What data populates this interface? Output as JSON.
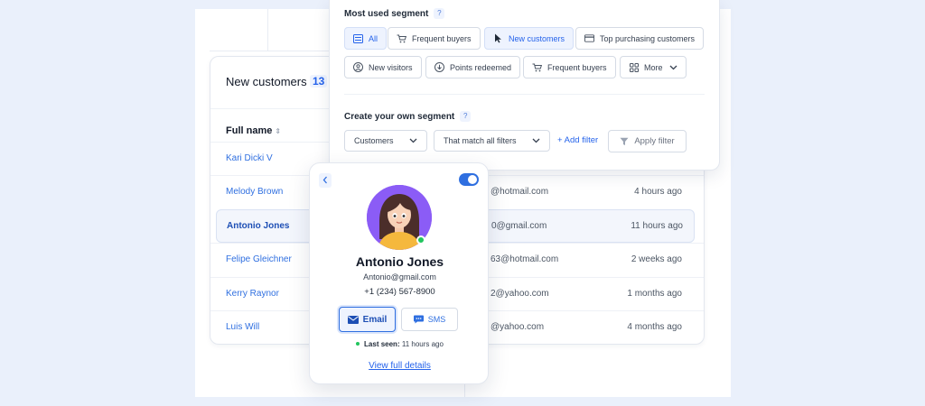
{
  "segments": {
    "title": "Most used segment",
    "help": "?",
    "chips": [
      {
        "label": "All",
        "icon": "list-icon"
      },
      {
        "label": "Frequent buyers",
        "icon": "cart-icon"
      },
      {
        "label": "New customers",
        "icon": "cursor-icon"
      },
      {
        "label": "Top purchasing customers",
        "icon": "card-icon"
      },
      {
        "label": "New visitors",
        "icon": "user-circle-icon"
      },
      {
        "label": "Points redeemed",
        "icon": "download-circle-icon"
      },
      {
        "label": "Frequent buyers",
        "icon": "cart-icon"
      },
      {
        "label": "More",
        "icon": "grid-icon"
      }
    ],
    "selected": "All"
  },
  "own_segment": {
    "title": "Create your own segment",
    "help": "?",
    "entity_select": "Customers",
    "match_select": "That match all filters",
    "add_filter": "+ Add filter",
    "apply_filter": "Apply filter"
  },
  "customers": {
    "title": "New customers",
    "count": "13",
    "column_name": "Full name",
    "rows": [
      {
        "name": "Kari Dicki V",
        "email": "",
        "time": ""
      },
      {
        "name": "Melody Brown",
        "email": "@hotmail.com",
        "time": "4 hours ago"
      },
      {
        "name": "Antonio Jones",
        "email": "0@gmail.com",
        "time": "11 hours ago"
      },
      {
        "name": "Felipe Gleichner",
        "email": "63@hotmail.com",
        "time": "2 weeks ago"
      },
      {
        "name": "Kerry Raynor",
        "email": "2@yahoo.com",
        "time": "1 months ago"
      },
      {
        "name": "Luis Will",
        "email": "@yahoo.com",
        "time": "4 months ago"
      }
    ],
    "active_row": "Antonio Jones"
  },
  "profile": {
    "name": "Antonio Jones",
    "email": "Antonio@gmail.com",
    "phone": "+1 (234) 567-8900",
    "email_button": "Email",
    "sms_button": "SMS",
    "last_seen_label": "Last seen:",
    "last_seen_value": "11 hours ago",
    "view_details": "View full details",
    "toggle_on": true,
    "online": true
  },
  "colors": {
    "accent": "#2f6fe0",
    "online": "#22c55e",
    "background": "#eaf0fb"
  }
}
